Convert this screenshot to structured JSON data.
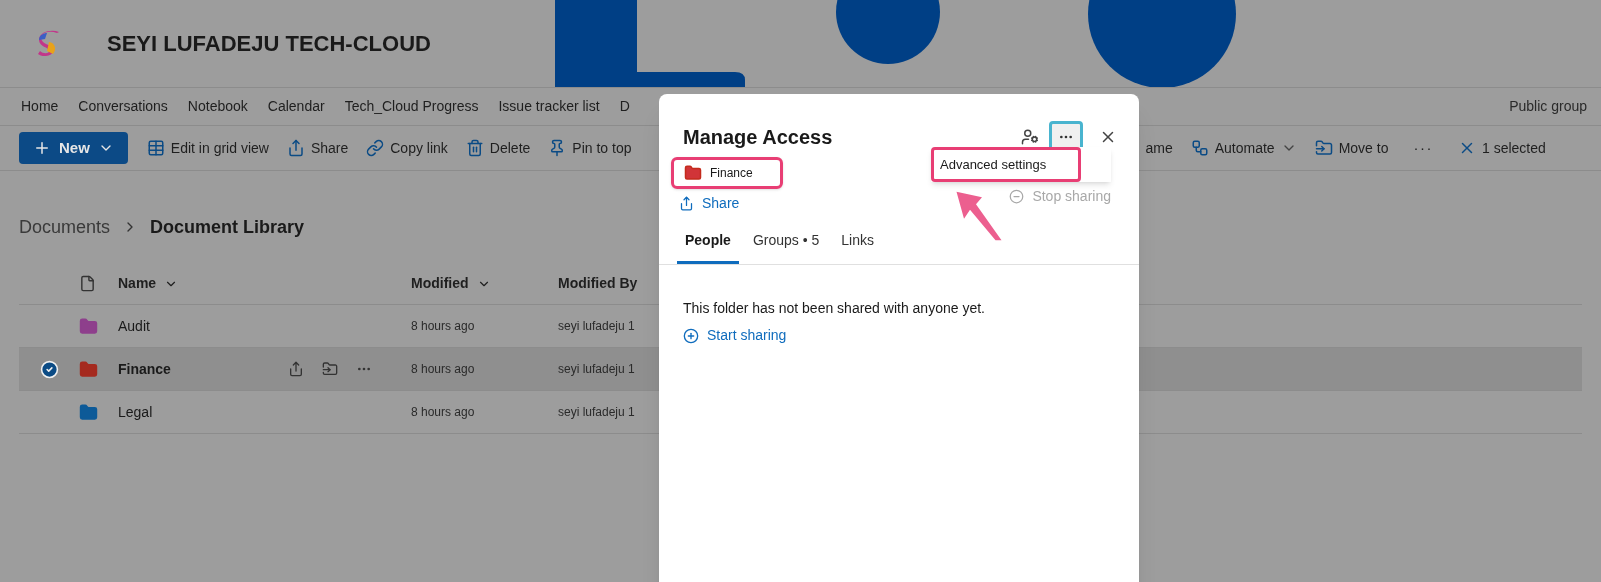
{
  "site": {
    "title": "SEYI LUFADEJU TECH-CLOUD",
    "visibility": "Public group"
  },
  "nav": [
    {
      "label": "Home"
    },
    {
      "label": "Conversations"
    },
    {
      "label": "Notebook"
    },
    {
      "label": "Calendar"
    },
    {
      "label": "Tech_Cloud Progress"
    },
    {
      "label": "Issue tracker list"
    },
    {
      "label": "D"
    }
  ],
  "toolbar": [
    {
      "label": "New",
      "kind": "new"
    },
    {
      "label": "Edit in grid view",
      "kind": "grid"
    },
    {
      "label": "Share",
      "kind": "share"
    },
    {
      "label": "Copy link",
      "kind": "link"
    },
    {
      "label": "Delete",
      "kind": "delete"
    },
    {
      "label": "Pin to top",
      "kind": "pin"
    }
  ],
  "toolbar_right": [
    {
      "label": "ame",
      "kind": "plain"
    },
    {
      "label": "Automate",
      "kind": "automate"
    },
    {
      "label": "Move to",
      "kind": "move"
    },
    {
      "label": "···",
      "kind": "more"
    },
    {
      "label": "1 selected",
      "kind": "clear"
    }
  ],
  "breadcrumb": [
    "Documents",
    "Document Library"
  ],
  "columns": [
    "Name",
    "Modified",
    "Modified By"
  ],
  "rows": [
    {
      "name": "Audit",
      "modified": "8 hours ago",
      "modified_by": "seyi lufadeju 1",
      "color": "#8e3f8c",
      "selected": false
    },
    {
      "name": "Finance",
      "modified": "8 hours ago",
      "modified_by": "seyi lufadeju 1",
      "color": "#a52a1f",
      "selected": true
    },
    {
      "name": "Legal",
      "modified": "8 hours ago",
      "modified_by": "seyi lufadeju 1",
      "color": "#0d5a98",
      "selected": false
    }
  ],
  "dialog": {
    "title": "Manage Access",
    "item": "Finance",
    "menu": [
      "Advanced settings"
    ],
    "share": "Share",
    "stop_sharing": {
      "label": "Stop sharing",
      "disabled": true
    },
    "tabs": [
      {
        "label": "People",
        "selected": true
      },
      {
        "label": "Groups • 5",
        "selected": false
      },
      {
        "label": "Links",
        "selected": false
      }
    ],
    "message": "This folder has not been shared with anyone yet.",
    "start_sharing": "Start sharing"
  }
}
